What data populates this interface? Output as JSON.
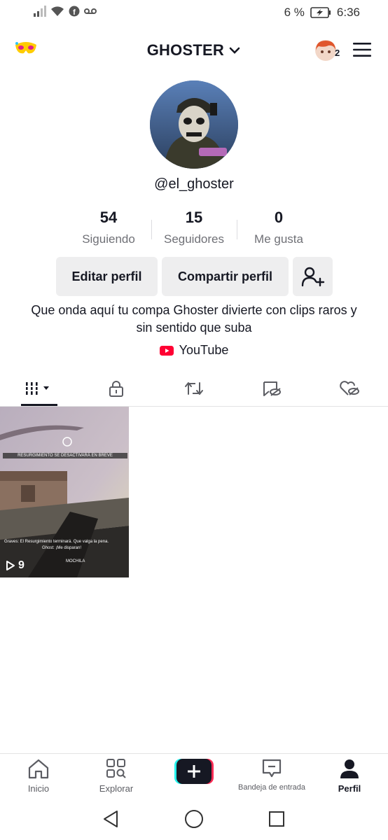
{
  "status_bar": {
    "battery": "6 %",
    "time": "6:36"
  },
  "header": {
    "title": "GHOSTER",
    "notification_count": "2"
  },
  "profile": {
    "username": "@el_ghoster",
    "stats": [
      {
        "value": "54",
        "label": "Siguiendo"
      },
      {
        "value": "15",
        "label": "Seguidores"
      },
      {
        "value": "0",
        "label": "Me gusta"
      }
    ],
    "edit_label": "Editar perfil",
    "share_label": "Compartir perfil",
    "bio": "Que onda aquí tu compa Ghoster divierte con clips raros y sin sentido que suba",
    "link_label": "YouTube"
  },
  "tabs": [
    "videos-grid-icon",
    "lock-icon",
    "repost-icon",
    "eye-off-icon",
    "heart-hidden-icon"
  ],
  "videos": [
    {
      "play_count": "9",
      "banner": "RESURGIMIENTO SE DESACTIVARÁ EN BREVE",
      "subtitle_1": "Graves: El Resurgimiento terminará. Que valga la pena.",
      "subtitle_2": "Ghost: ¡Me disparan!",
      "hud_label": "MOCHILA"
    }
  ],
  "bottom_nav": [
    {
      "label": "Inicio"
    },
    {
      "label": "Explorar"
    },
    {
      "label": ""
    },
    {
      "label": "Bandeja de entrada"
    },
    {
      "label": "Perfil"
    }
  ],
  "colors": {
    "accent_cyan": "#25f4ee",
    "accent_red": "#fe2c55",
    "youtube_red": "#ff0033"
  }
}
